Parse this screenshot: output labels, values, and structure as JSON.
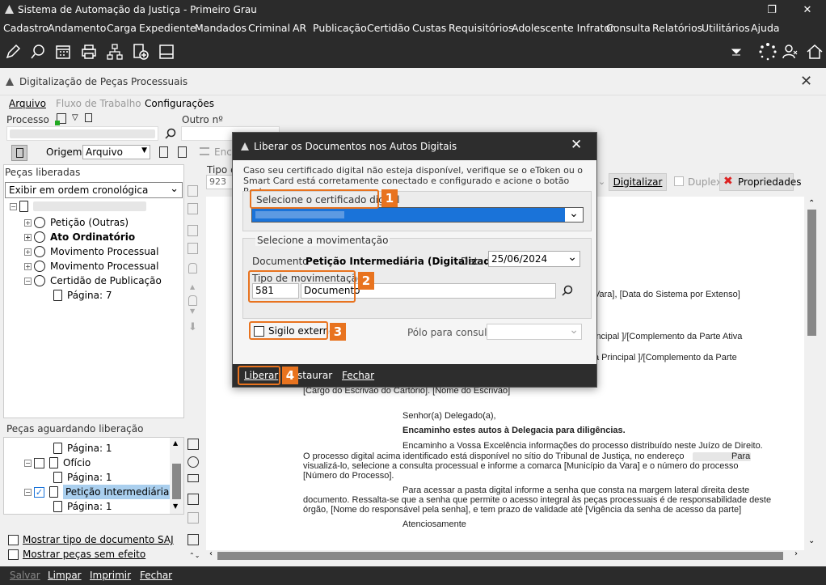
{
  "window": {
    "title": "Sistema de Automação da Justiça - Primeiro Grau"
  },
  "menu": [
    "Cadastro",
    "Andamento",
    "Carga",
    "Expediente",
    "Mandados",
    "Criminal",
    "AR",
    "Publicação",
    "Certidão",
    "Custas",
    "Requisitórios",
    "Adolescente Infrator",
    "Consulta",
    "Relatórios",
    "Utilitários",
    "Ajuda"
  ],
  "subwindow": {
    "title": "Digitalização de Peças Processuais"
  },
  "submenu": {
    "arquivo": "Arquivo",
    "fluxo": "Fluxo de Trabalho",
    "config": "Configurações"
  },
  "search": {
    "processo_label": "Processo",
    "outro_label": "Outro nº",
    "origem_label": "Origem",
    "origem_value": "Arquivo",
    "tipo_label": "Tipo d",
    "tipo_value": "923",
    "enc_label": "Enc"
  },
  "pecas": {
    "header": "Peças liberadas",
    "order": "Exibir em ordem cronológica",
    "items": [
      "Petição (Outras)",
      "Ato Ordinatório",
      "Movimento Processual",
      "Movimento Processual",
      "Certidão de Publicação"
    ],
    "page_label": "Página: 7"
  },
  "aguardando": {
    "header": "Peças aguardando liberação",
    "items": [
      {
        "label": "Página: 1"
      },
      {
        "label": "Ofício"
      },
      {
        "label": "Página: 1"
      },
      {
        "label": "Petição Intermediária"
      },
      {
        "label": "Página: 1"
      }
    ]
  },
  "options": {
    "show_type": "Mostrar tipo de documento SAJ",
    "show_no_effect": "Mostrar peças sem efeito"
  },
  "right_toolbar": {
    "digitalizar": "Digitalizar",
    "duplex": "Duplex",
    "propriedades": "Propriedades"
  },
  "document_lines": {
    "l1": "Vara], [Data do Sistema por Extenso]",
    "l2": "incipal ]/[Complemento da Parte Ativa",
    "l3": "a Principal ]/[Complemento da Parte",
    "l4": "[Cargo do Escrivão do Cartório]. [Nome do Escrivão]",
    "l5": "Senhor(a) Delegado(a),",
    "l6": "Encaminho estes autos à Delegacia para diligências.",
    "l7": "Encaminho a Vossa Excelência informações do processo distribuído neste Juízo de Direito.",
    "l8a": "O processo digital acima identificado está disponível no sítio do Tribunal de Justiça, no endereço",
    "l8b": "Para",
    "l9": "visualizá-lo, selecione a consulta processual e informe a comarca  [Município da Vara] e o número do processo",
    "l10": "[Número do Processo].",
    "l11": "Para acessar a pasta digital informe a senha que consta na margem lateral direita deste",
    "l12": "documento. Ressalta-se que a senha que permite o acesso integral às peças processuais é de responsabilidade deste",
    "l13": "órgão, [Nome do responsável pela senha], e tem prazo de validade até [Vigência da senha de acesso da parte]",
    "l14": "Atenciosamente"
  },
  "dialog": {
    "title": "Liberar os Documentos nos Autos Digitais",
    "info": "Caso seu certificado digital não esteja disponível, verifique se o eToken ou o Smart Card está corretamente conectado e configurado e acione o botão Restaurar.",
    "cert_label": "Selecione o certificado digital",
    "mov_label": "Selecione a movimentação",
    "doc_label": "Documento",
    "doc_value": "Petição Intermediária (Digitalizada)",
    "date_label": "Data",
    "date_value": "25/06/2024",
    "tipo_mov_label": "Tipo de movimentação",
    "tipo_code": "581",
    "tipo_name": "Documento",
    "sigilo_label": "Sigilo externo",
    "polo_label": "Pólo para consulta",
    "btn_liberar": "Liberar",
    "btn_restaurar": "staurar",
    "btn_fechar": "Fechar",
    "callouts": [
      "1",
      "2",
      "3",
      "4"
    ]
  },
  "bottom": {
    "salvar": "Salvar",
    "limpar": "Limpar",
    "imprimir": "Imprimir",
    "fechar": "Fechar"
  },
  "colors": {
    "accent": "#e8731f",
    "selection": "#1a73d9",
    "dark": "#2b2b2b"
  }
}
